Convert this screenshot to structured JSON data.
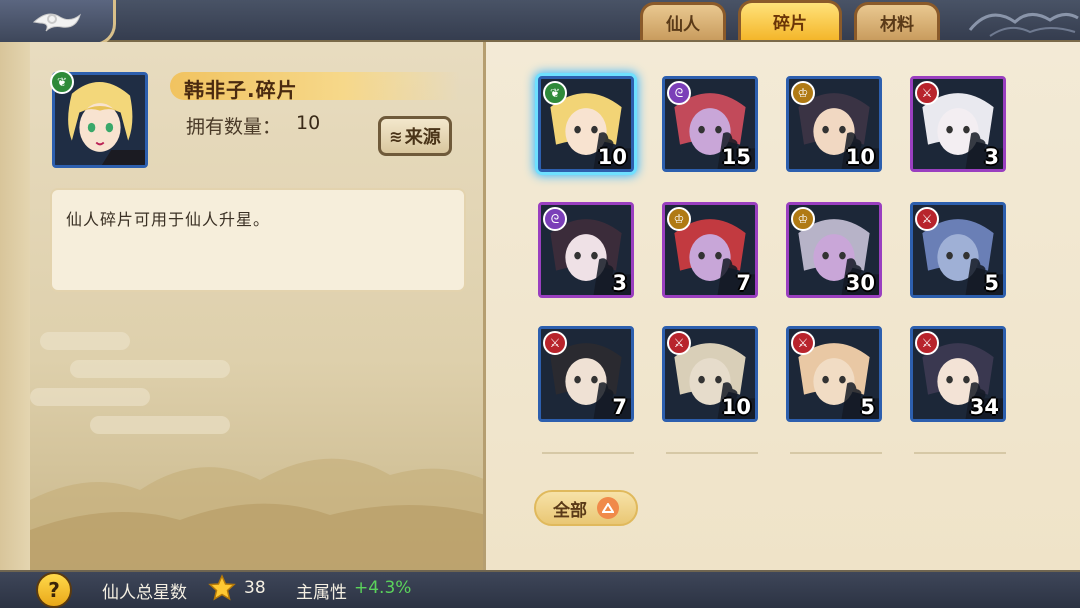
{
  "tabs": [
    {
      "label": "仙人",
      "active": false
    },
    {
      "label": "碎片",
      "active": true
    },
    {
      "label": "材料",
      "active": false
    }
  ],
  "detail": {
    "name": "韩非子.碎片",
    "count_label": "拥有数量：",
    "count_value": "10",
    "source_button": "来源",
    "description": "仙人碎片可用于仙人升星。",
    "element_icon": "leaf-icon"
  },
  "fragments": [
    {
      "count": "10",
      "element": "leaf",
      "frame": "blue",
      "selected": true
    },
    {
      "count": "15",
      "element": "spiral",
      "frame": "blue",
      "selected": false
    },
    {
      "count": "10",
      "element": "crown",
      "frame": "blue",
      "selected": false
    },
    {
      "count": "3",
      "element": "sword",
      "frame": "purple",
      "selected": false
    },
    {
      "count": "3",
      "element": "spiral",
      "frame": "purple",
      "selected": false
    },
    {
      "count": "7",
      "element": "crown",
      "frame": "purple",
      "selected": false
    },
    {
      "count": "30",
      "element": "crown",
      "frame": "purple",
      "selected": false
    },
    {
      "count": "5",
      "element": "sword",
      "frame": "blue",
      "selected": false
    },
    {
      "count": "7",
      "element": "sword",
      "frame": "blue",
      "selected": false
    },
    {
      "count": "10",
      "element": "sword",
      "frame": "blue",
      "selected": false
    },
    {
      "count": "5",
      "element": "sword",
      "frame": "blue",
      "selected": false
    },
    {
      "count": "34",
      "element": "sword",
      "frame": "blue",
      "selected": false
    }
  ],
  "filter_button": "全部",
  "footer": {
    "total_stars_label": "仙人总星数",
    "total_stars_value": "38",
    "main_attr_label": "主属性",
    "main_attr_value": "+4.3%"
  },
  "colors": {
    "leaf": "#2f8a3a",
    "spiral": "#7b3fb8",
    "crown": "#b07a14",
    "sword": "#b8242c"
  }
}
